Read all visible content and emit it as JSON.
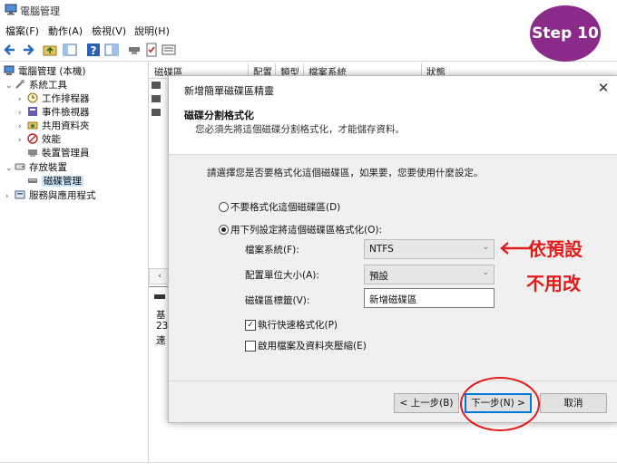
{
  "window": {
    "title": "電腦管理"
  },
  "menu": [
    "檔案(F)",
    "動作(A)",
    "檢視(V)",
    "說明(H)"
  ],
  "step_badge": "Step 10",
  "tree": {
    "root": "電腦管理 (本機)",
    "system_tools": "系統工具",
    "task_scheduler": "工作排程器",
    "event_viewer": "事件檢視器",
    "shared_folders": "共用資料夾",
    "performance": "效能",
    "device_manager": "裝置管理員",
    "storage": "存放裝置",
    "disk_management": "磁碟管理",
    "services": "服務與應用程式"
  },
  "columns": [
    "磁碟區",
    "配置",
    "類型",
    "檔案系統",
    "狀態"
  ],
  "disk_info": [
    "基",
    "23",
    "連"
  ],
  "dialog": {
    "title": "新增簡單磁碟區精靈",
    "heading": "磁碟分割格式化",
    "description": "您必須先將這個磁碟分割格式化，才能儲存資料。",
    "prompt": "請選擇您是否要格式化這個磁碟區，如果要，您要使用什麼設定。",
    "opt_no_format": "不要格式化這個磁碟區(D)",
    "opt_format": "用下列設定將這個磁碟區格式化(O):",
    "fs_label": "檔案系統(F):",
    "fs_value": "NTFS",
    "alloc_label": "配置單位大小(A):",
    "alloc_value": "預設",
    "vol_label": "磁碟區標籤(V):",
    "vol_value": "新增磁碟區",
    "quick_format": "執行快速格式化(P)",
    "compression": "啟用檔案及資料夾壓縮(E)",
    "back": "< 上一步(B)",
    "next": "下一步(N) >",
    "cancel": "取消"
  },
  "annotation": {
    "line1": "依預設",
    "line2": "不用改"
  },
  "colors": {
    "badge": "#8a2b89",
    "annotation": "#e31a1a",
    "accent": "#0078d7"
  }
}
